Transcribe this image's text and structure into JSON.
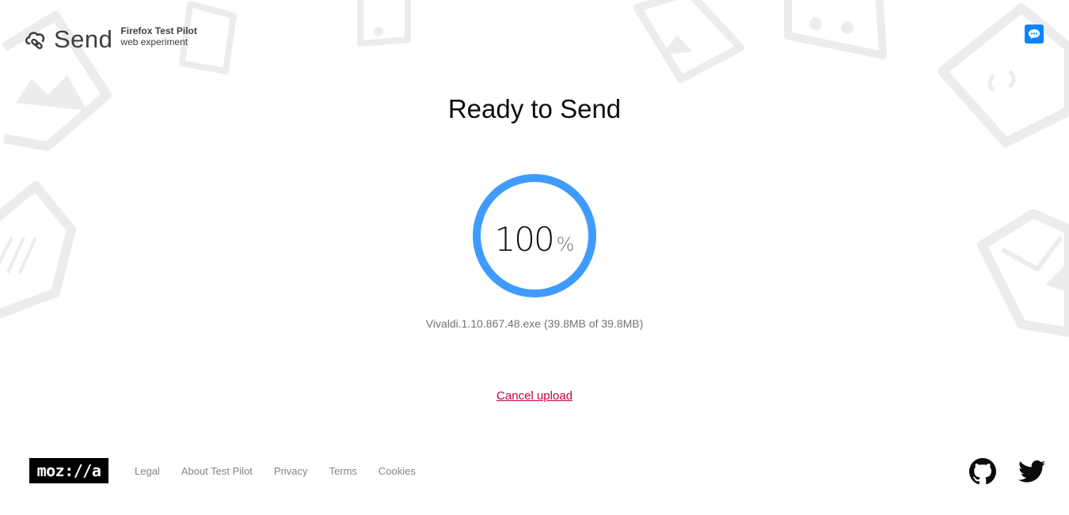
{
  "header": {
    "app_name": "Send",
    "pilot_title": "Firefox Test Pilot",
    "pilot_subtitle": "web experiment",
    "feedback_icon": "chat-bubble-icon"
  },
  "main": {
    "title": "Ready to Send",
    "progress": {
      "value": 100,
      "display_value": "100",
      "unit": "%",
      "ring_color": "#3f9bff"
    },
    "file_info": "Vivaldi.1.10.867.48.exe (39.8MB of 39.8MB)",
    "cancel_label": "Cancel upload"
  },
  "footer": {
    "logo_text": "moz://a",
    "links": [
      "Legal",
      "About Test Pilot",
      "Privacy",
      "Terms",
      "Cookies"
    ],
    "social": [
      "github-icon",
      "twitter-icon"
    ]
  },
  "colors": {
    "accent": "#0a84ff",
    "cancel": "#c50042",
    "muted_text": "#737373"
  }
}
